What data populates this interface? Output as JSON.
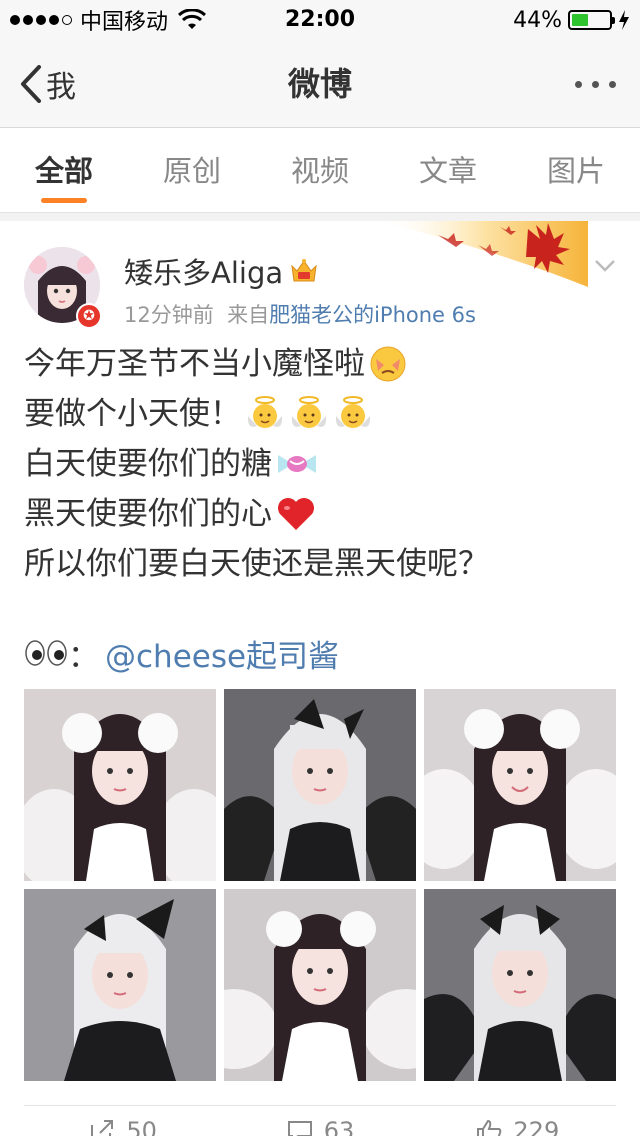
{
  "status_bar": {
    "carrier": "中国移动",
    "time": "22:00",
    "battery": "44%",
    "battery_level": 0.44
  },
  "nav": {
    "back_label": "我",
    "title": "微博"
  },
  "tabs": [
    {
      "label": "全部",
      "active": true
    },
    {
      "label": "原创",
      "active": false
    },
    {
      "label": "视频",
      "active": false
    },
    {
      "label": "文章",
      "active": false
    },
    {
      "label": "图片",
      "active": false
    }
  ],
  "post": {
    "username": "矮乐多Aliga",
    "time_ago": "12分钟前",
    "source_prefix": "来自",
    "source": "肥猫老公的iPhone 6s",
    "lines": [
      "今年万圣节不当小魔怪啦",
      "要做个小天使！",
      "白天使要你们的糖",
      "黑天使要你们的心",
      "所以你们要白天使还是黑天使呢？"
    ],
    "mention_sep": "：",
    "mention": "@cheese起司酱",
    "photos": [
      "white",
      "black",
      "white",
      "black",
      "white",
      "black"
    ]
  },
  "actions": [
    {
      "name": "repost",
      "count": "50"
    },
    {
      "name": "comment",
      "count": "63"
    },
    {
      "name": "like",
      "count": "229"
    }
  ],
  "colors": {
    "accent": "#fd8225",
    "link": "#507daf",
    "battery": "#2ec42e"
  }
}
